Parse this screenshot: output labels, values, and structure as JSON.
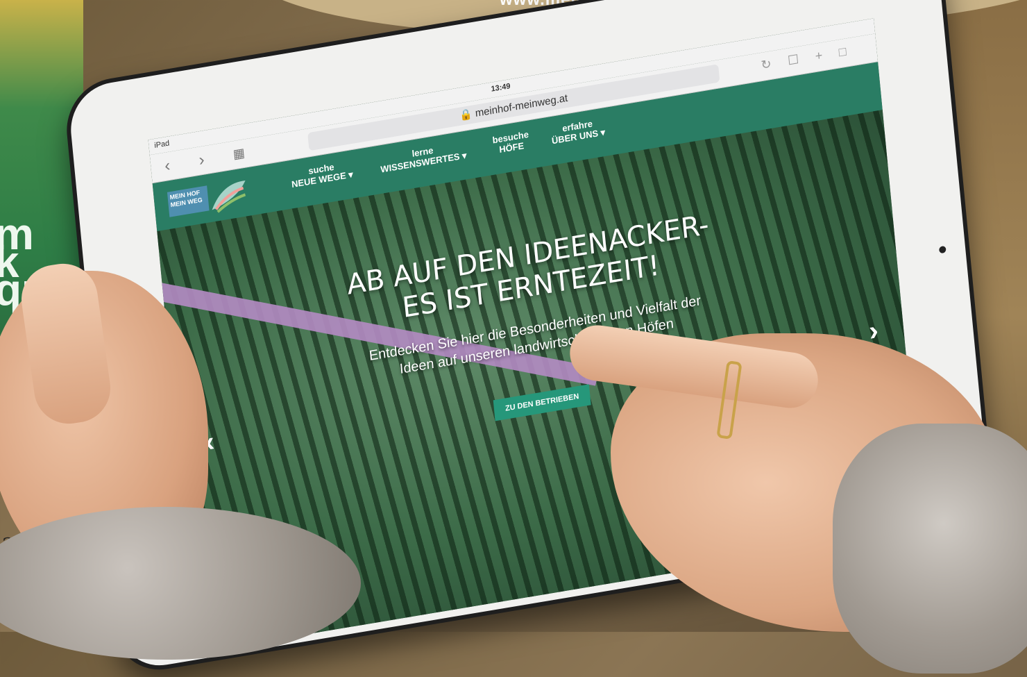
{
  "banner": {
    "text": "www.meinhof-meinweg.at"
  },
  "background": {
    "lettering": [
      "m",
      "k",
      "qu"
    ],
    "handwriting": "24"
  },
  "tablet": {
    "status": {
      "device": "iPad",
      "time": "13:49"
    },
    "browser": {
      "url": "meinhof-meinweg.at",
      "back": "‹",
      "forward": "›"
    },
    "site": {
      "logo": {
        "line1": "MEIN HOF",
        "line2": "MEIN WEG"
      },
      "nav": [
        {
          "small": "suche",
          "large": "NEUE WEGE ▾"
        },
        {
          "small": "lerne",
          "large": "WISSENSWERTES ▾"
        },
        {
          "small": "besuche",
          "large": "HÖFE"
        },
        {
          "small": "erfahre",
          "large": "ÜBER UNS ▾"
        }
      ],
      "hero": {
        "title_line1": "AB AUF DEN IDEENACKER-",
        "title_line2": "ES IST ERNTEZEIT!",
        "subtitle_line1": "Entdecken Sie hier die Besonderheiten und Vielfalt der",
        "subtitle_line2": "Ideen auf unseren landwirtschaftlichen Höfen",
        "cta": "ZU DEN BETRIEBEN",
        "prev": "‹",
        "next": "›"
      }
    }
  },
  "colors": {
    "nav": "#2a7d64",
    "cta": "#26977a",
    "banner": "#c8b287"
  }
}
